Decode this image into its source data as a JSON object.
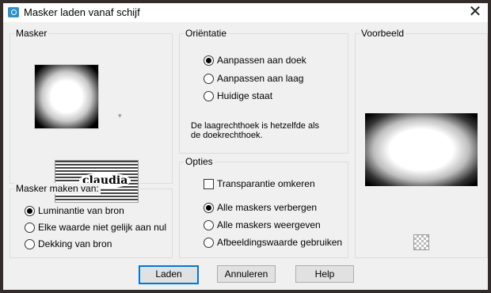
{
  "window": {
    "title": "Masker laden vanaf schijf",
    "close_symbol": "✕"
  },
  "masker_group": {
    "label": "Masker",
    "caret": "▾",
    "logo_text": "claudia"
  },
  "maken_group": {
    "label": "Masker maken van:",
    "options": [
      {
        "label": "Luminantie van bron",
        "checked": true
      },
      {
        "label": "Elke waarde niet gelijk aan nul",
        "checked": false
      },
      {
        "label": "Dekking van bron",
        "checked": false
      }
    ]
  },
  "orientatie_group": {
    "label": "Oriëntatie",
    "options": [
      {
        "label": "Aanpassen aan doek",
        "checked": true
      },
      {
        "label": "Aanpassen aan laag",
        "checked": false
      },
      {
        "label": "Huidige staat",
        "checked": false
      }
    ],
    "info_line1": "De laagrechthoek is hetzelfde als",
    "info_line2": "de doekrechthoek."
  },
  "opties_group": {
    "label": "Opties",
    "checkbox": {
      "label": "Transparantie omkeren",
      "checked": false
    },
    "options": [
      {
        "label": "Alle maskers verbergen",
        "checked": true
      },
      {
        "label": "Alle maskers weergeven",
        "checked": false
      },
      {
        "label": "Afbeeldingswaarde gebruiken",
        "checked": false
      }
    ]
  },
  "voorbeeld_group": {
    "label": "Voorbeeld"
  },
  "buttons": {
    "load": "Laden",
    "cancel": "Annuleren",
    "help": "Help"
  }
}
